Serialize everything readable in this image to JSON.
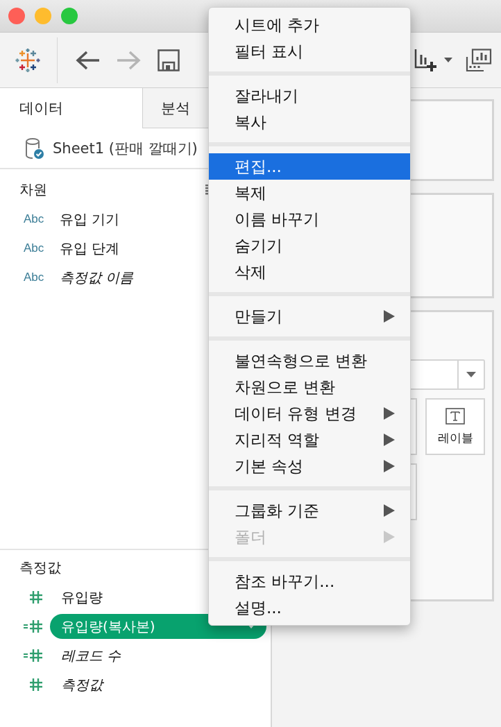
{
  "window": {
    "traffic_lights": [
      {
        "color": "#fe5f57"
      },
      {
        "color": "#febc2e"
      },
      {
        "color": "#28c840"
      }
    ]
  },
  "toolbar": {
    "back_disabled": false,
    "forward_disabled": true
  },
  "left_panel": {
    "tabs": [
      {
        "label": "데이터",
        "selected": true
      },
      {
        "label": "분석",
        "selected": false
      }
    ],
    "datasource": "Sheet1 (판매 깔때기)",
    "dimensions": {
      "title": "차원",
      "items": [
        {
          "type": "Abc",
          "label": "유입 기기",
          "italic": false
        },
        {
          "type": "Abc",
          "label": "유입 단계",
          "italic": false
        },
        {
          "type": "Abc",
          "label": "측정값 이름",
          "italic": true
        }
      ]
    },
    "measures": {
      "title": "측정값",
      "items": [
        {
          "label": "유입량",
          "italic": false,
          "calculated": false,
          "selected": false
        },
        {
          "label": "유입량(복사본)",
          "italic": false,
          "calculated": true,
          "selected": true
        },
        {
          "label": "레코드 수",
          "italic": true,
          "calculated": true,
          "selected": false
        },
        {
          "label": "측정값",
          "italic": true,
          "calculated": false,
          "selected": false
        }
      ]
    }
  },
  "marks_card": {
    "label_button": "레이블"
  },
  "context_menu": {
    "groups": [
      [
        {
          "label": "시트에 추가",
          "selected": false,
          "disabled": false,
          "submenu": false
        },
        {
          "label": "필터 표시",
          "selected": false,
          "disabled": false,
          "submenu": false
        }
      ],
      [
        {
          "label": "잘라내기",
          "selected": false,
          "disabled": false,
          "submenu": false
        },
        {
          "label": "복사",
          "selected": false,
          "disabled": false,
          "submenu": false
        }
      ],
      [
        {
          "label": "편집...",
          "selected": true,
          "disabled": false,
          "submenu": false
        },
        {
          "label": "복제",
          "selected": false,
          "disabled": false,
          "submenu": false
        },
        {
          "label": "이름 바꾸기",
          "selected": false,
          "disabled": false,
          "submenu": false
        },
        {
          "label": "숨기기",
          "selected": false,
          "disabled": false,
          "submenu": false
        },
        {
          "label": "삭제",
          "selected": false,
          "disabled": false,
          "submenu": false
        }
      ],
      [
        {
          "label": "만들기",
          "selected": false,
          "disabled": false,
          "submenu": true
        }
      ],
      [
        {
          "label": "불연속형으로 변환",
          "selected": false,
          "disabled": false,
          "submenu": false
        },
        {
          "label": "차원으로 변환",
          "selected": false,
          "disabled": false,
          "submenu": false
        },
        {
          "label": "데이터 유형 변경",
          "selected": false,
          "disabled": false,
          "submenu": true
        },
        {
          "label": "지리적 역할",
          "selected": false,
          "disabled": false,
          "submenu": true
        },
        {
          "label": "기본 속성",
          "selected": false,
          "disabled": false,
          "submenu": true
        }
      ],
      [
        {
          "label": "그룹화 기준",
          "selected": false,
          "disabled": false,
          "submenu": true
        },
        {
          "label": "폴더",
          "selected": false,
          "disabled": true,
          "submenu": true
        }
      ],
      [
        {
          "label": "참조 바꾸기...",
          "selected": false,
          "disabled": false,
          "submenu": false
        },
        {
          "label": "설명...",
          "selected": false,
          "disabled": false,
          "submenu": false
        }
      ]
    ]
  }
}
